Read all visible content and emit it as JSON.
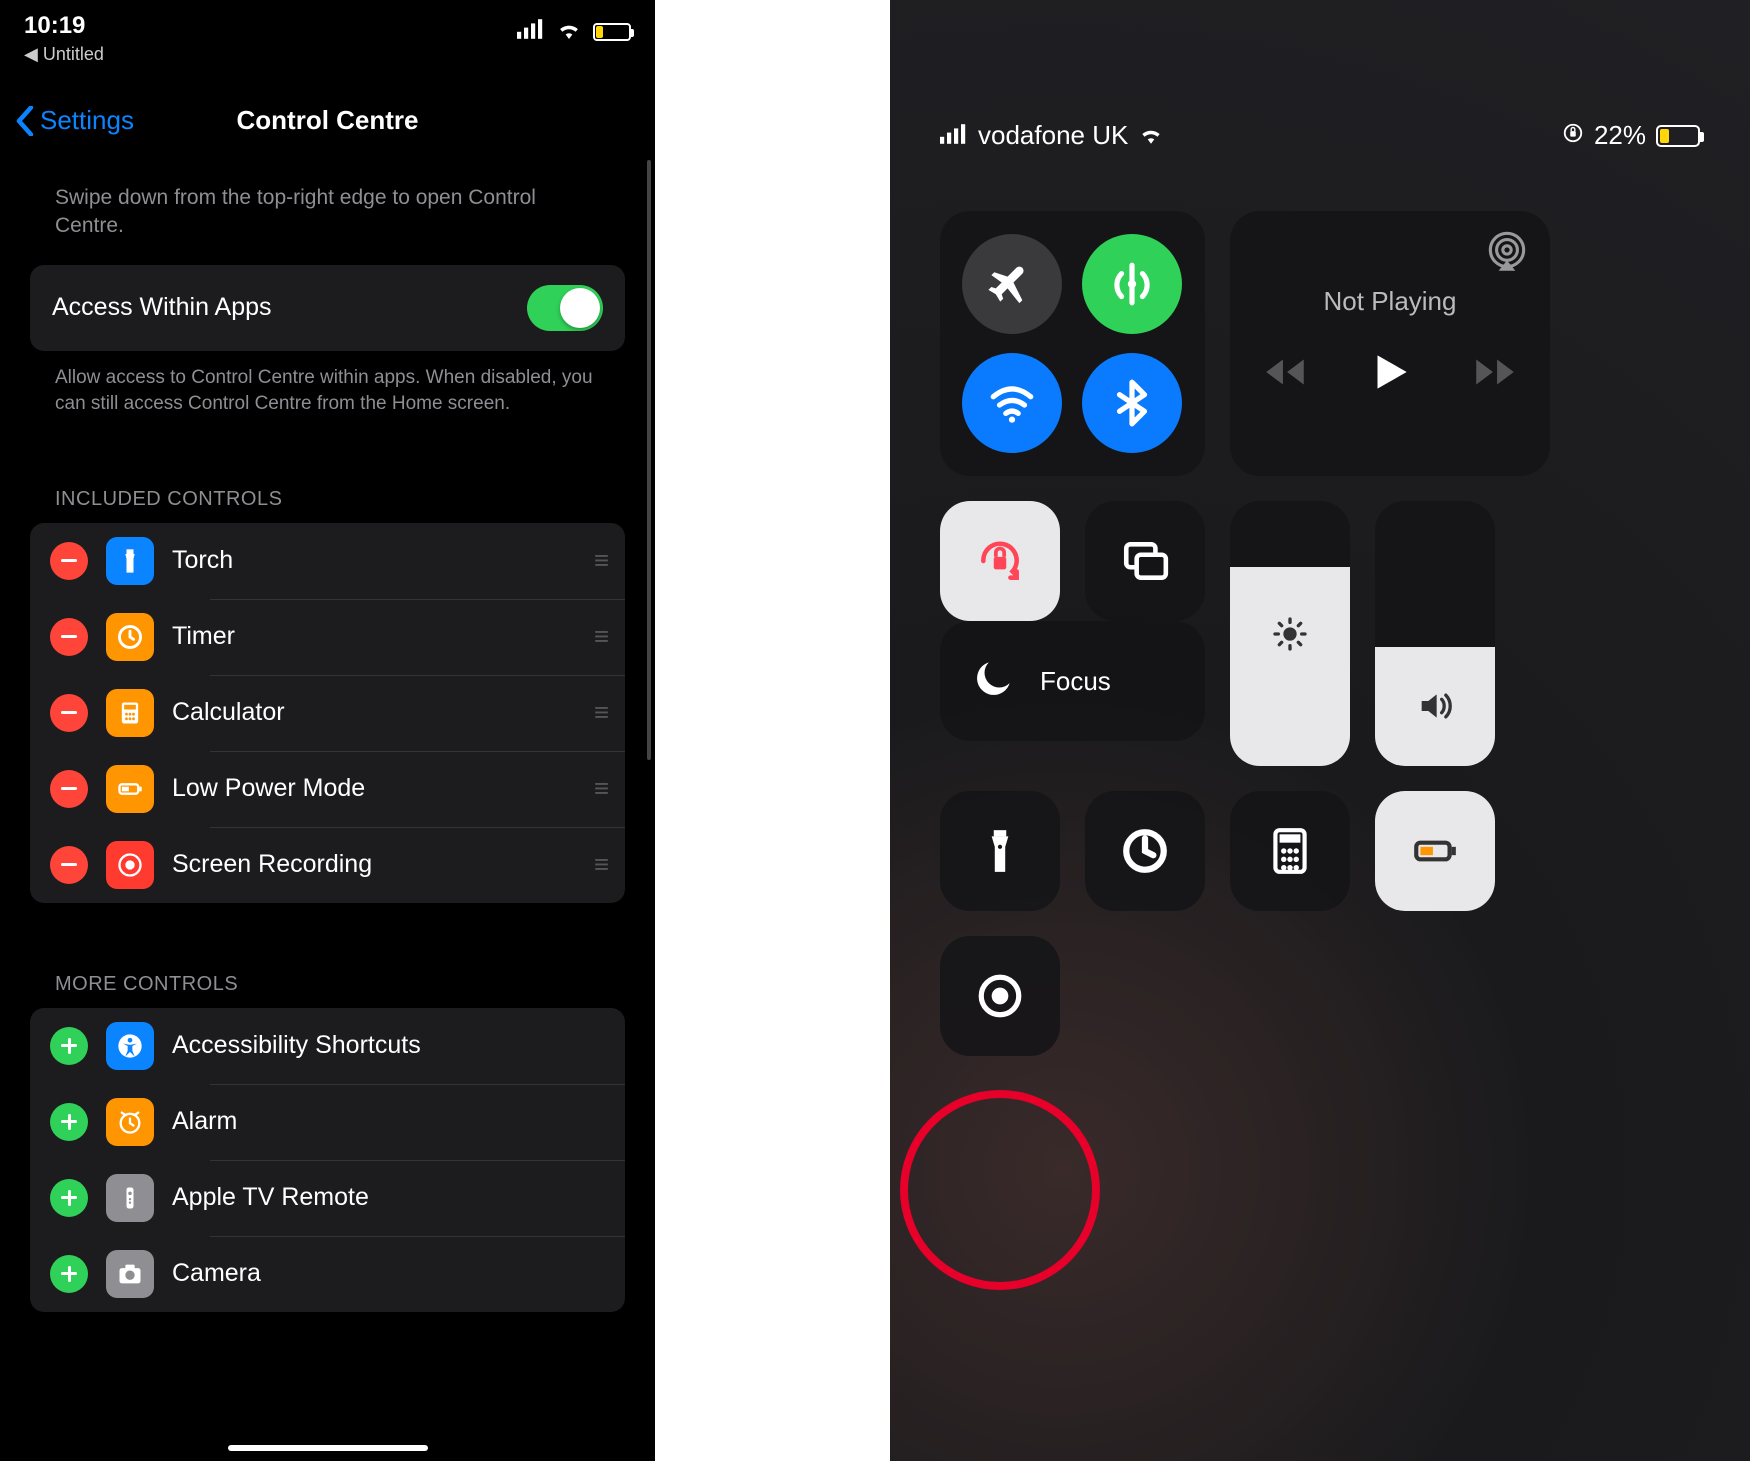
{
  "left": {
    "status": {
      "time": "10:19",
      "back_app": "◀ Untitled"
    },
    "nav": {
      "back": "Settings",
      "title": "Control Centre"
    },
    "hint1": "Swipe down from the top-right edge to open Control Centre.",
    "access_label": "Access Within Apps",
    "footer1": "Allow access to Control Centre within apps. When disabled, you can still access Control Centre from the Home screen.",
    "section_included": "INCLUDED CONTROLS",
    "included": [
      {
        "label": "Torch"
      },
      {
        "label": "Timer"
      },
      {
        "label": "Calculator"
      },
      {
        "label": "Low Power Mode"
      },
      {
        "label": "Screen Recording"
      }
    ],
    "section_more": "MORE CONTROLS",
    "more": [
      {
        "label": "Accessibility Shortcuts"
      },
      {
        "label": "Alarm"
      },
      {
        "label": "Apple TV Remote"
      },
      {
        "label": "Camera"
      }
    ]
  },
  "right": {
    "status": {
      "carrier": "vodafone UK",
      "battery_pct": "22%"
    },
    "media_title": "Not Playing",
    "focus_label": "Focus"
  }
}
